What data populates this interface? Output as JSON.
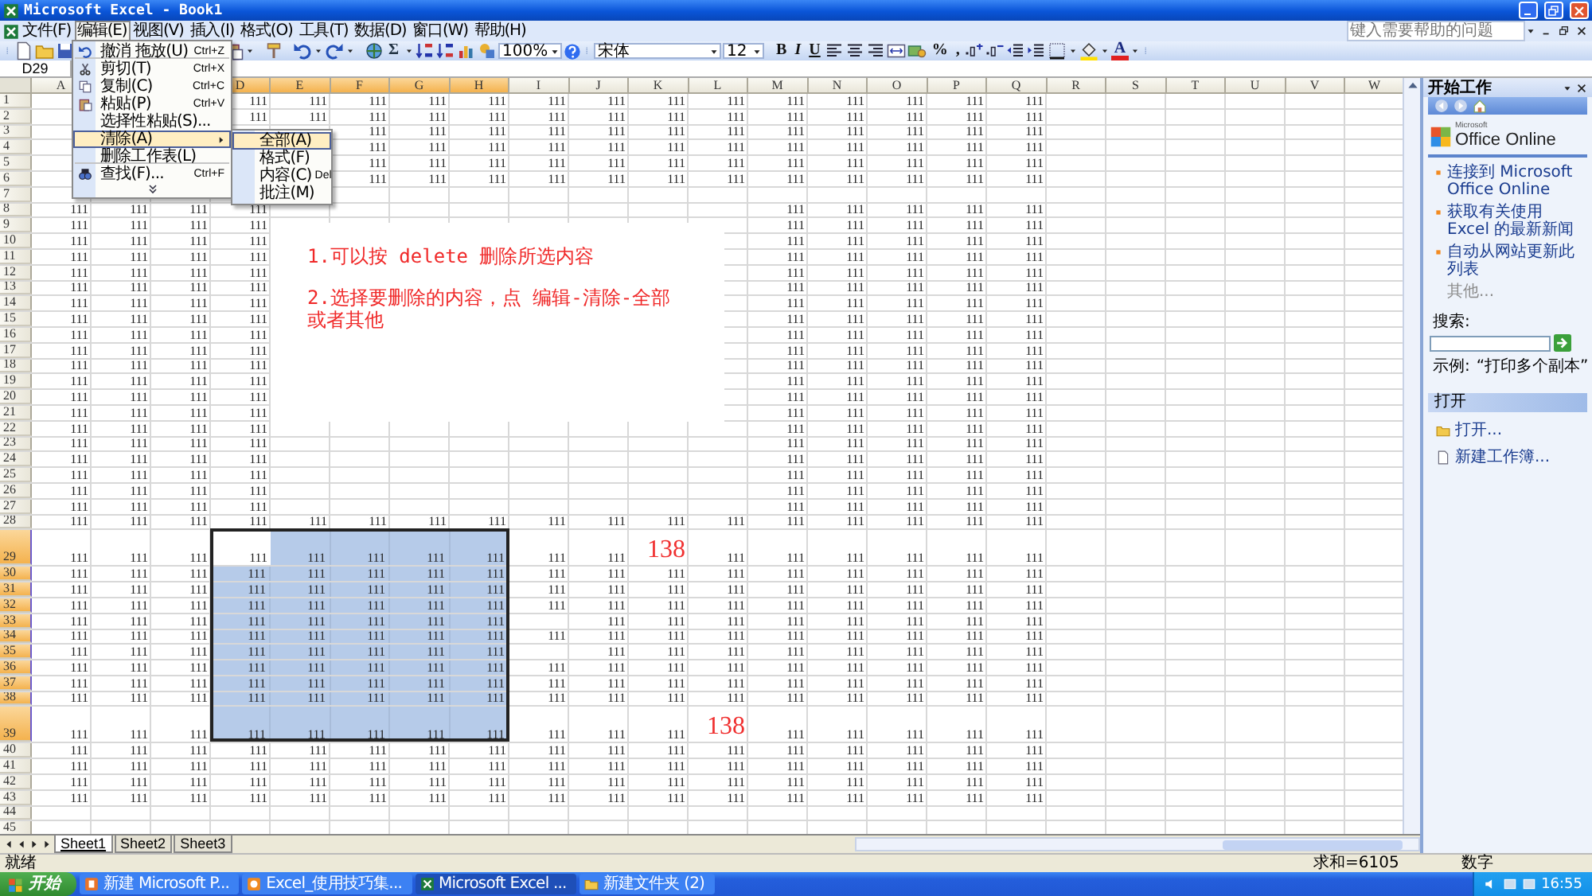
{
  "window": {
    "title": "Microsoft Excel - Book1"
  },
  "menu_bar": {
    "items": [
      {
        "label": "文件(F)",
        "selected": false
      },
      {
        "label": "编辑(E)",
        "selected": true
      },
      {
        "label": "视图(V)",
        "selected": false
      },
      {
        "label": "插入(I)",
        "selected": false
      },
      {
        "label": "格式(O)",
        "selected": false
      },
      {
        "label": "工具(T)",
        "selected": false
      },
      {
        "label": "数据(D)",
        "selected": false
      },
      {
        "label": "窗口(W)",
        "selected": false
      },
      {
        "label": "帮助(H)",
        "selected": false
      }
    ],
    "help_placeholder": "键入需要帮助的问题"
  },
  "toolbar": {
    "sum": "Σ",
    "zoom": "100%",
    "font": "宋体",
    "font_size": "12",
    "bold": "B",
    "italic": "I",
    "underline": "U",
    "percent": "%",
    "comma": ",",
    "font_color": "A"
  },
  "name_box": "D29",
  "edit_menu": {
    "items": [
      {
        "label": "撤消 拖放(U)",
        "shortcut": "Ctrl+Z",
        "selected": false,
        "has_submenu": false,
        "separator_after": true
      },
      {
        "label": "剪切(T)",
        "shortcut": "Ctrl+X",
        "selected": false,
        "has_submenu": false,
        "separator_after": false
      },
      {
        "label": "复制(C)",
        "shortcut": "Ctrl+C",
        "selected": false,
        "has_submenu": false,
        "separator_after": false
      },
      {
        "label": "粘贴(P)",
        "shortcut": "Ctrl+V",
        "selected": false,
        "has_submenu": false,
        "separator_after": false
      },
      {
        "label": "选择性粘贴(S)...",
        "selected": false,
        "has_submenu": false,
        "separator_after": false
      },
      {
        "label": "清除(A)",
        "selected": true,
        "has_submenu": true,
        "separator_after": false
      },
      {
        "label": "删除工作表(L)",
        "selected": false,
        "has_submenu": false,
        "separator_after": true
      },
      {
        "label": "查找(F)...",
        "shortcut": "Ctrl+F",
        "selected": false,
        "has_submenu": false,
        "separator_after": false
      }
    ]
  },
  "clear_submenu": {
    "items": [
      {
        "label": "全部(A)",
        "selected": true
      },
      {
        "label": "格式(F)",
        "selected": false
      },
      {
        "label": "内容(C)",
        "shortcut": "Del",
        "selected": false
      },
      {
        "label": "批注(M)",
        "selected": false
      }
    ]
  },
  "columns": [
    {
      "label": "A",
      "selected": false
    },
    {},
    {},
    {
      "label": "D",
      "selected": true
    },
    {
      "label": "E",
      "selected": true
    },
    {
      "label": "F",
      "selected": true
    },
    {
      "label": "G",
      "selected": true
    },
    {
      "label": "H",
      "selected": true
    },
    {
      "label": "I",
      "selected": false
    },
    {
      "label": "J",
      "selected": false
    },
    {
      "label": "K",
      "selected": false
    },
    {
      "label": "L",
      "selected": false
    },
    {
      "label": "M",
      "selected": false
    },
    {
      "label": "N",
      "selected": false
    },
    {
      "label": "O",
      "selected": false
    },
    {
      "label": "P",
      "selected": false
    },
    {
      "label": "Q",
      "selected": false
    },
    {
      "label": "R",
      "selected": false
    },
    {
      "label": "S",
      "selected": false
    },
    {
      "label": "T",
      "selected": false
    },
    {
      "label": "U",
      "selected": false
    },
    {
      "label": "V",
      "selected": false
    },
    {
      "label": "W",
      "selected": false
    }
  ],
  "rows": [
    {
      "header": "1",
      "kind": "normal",
      "selected": false,
      "cells": [
        null,
        null,
        null,
        "111",
        "111",
        "111",
        "111",
        "111",
        "111",
        "111",
        "111",
        "111",
        "111",
        "111",
        "111",
        "111",
        "111"
      ]
    },
    {
      "header": "2",
      "kind": "normal",
      "selected": false,
      "cells": [
        null,
        null,
        null,
        "111",
        "111",
        "111",
        "111",
        "111",
        "111",
        "111",
        "111",
        "111",
        "111",
        "111",
        "111",
        "111",
        "111"
      ]
    },
    {
      "header": "3",
      "kind": "normal",
      "selected": false,
      "cells": [
        null,
        null,
        null,
        null,
        null,
        "111",
        "111",
        "111",
        "111",
        "111",
        "111",
        "111",
        "111",
        "111",
        "111",
        "111",
        "111"
      ]
    },
    {
      "header": "4",
      "kind": "normal",
      "selected": false,
      "cells": [
        null,
        null,
        null,
        null,
        null,
        "111",
        "111",
        "111",
        "111",
        "111",
        "111",
        "111",
        "111",
        "111",
        "111",
        "111",
        "111"
      ]
    },
    {
      "header": "5",
      "kind": "normal",
      "selected": false,
      "cells": [
        null,
        null,
        null,
        null,
        null,
        "111",
        "111",
        "111",
        "111",
        "111",
        "111",
        "111",
        "111",
        "111",
        "111",
        "111",
        "111"
      ]
    },
    {
      "header": "6",
      "kind": "normal",
      "selected": false,
      "cells": [
        null,
        null,
        null,
        null,
        null,
        "111",
        "111",
        "111",
        "111",
        "111",
        "111",
        "111",
        "111",
        "111",
        "111",
        "111",
        "111"
      ]
    },
    {
      "header": "7",
      "kind": "normal",
      "selected": false
    },
    {
      "header": "8",
      "kind": "normal",
      "selected": false,
      "cells": [
        "111",
        "111",
        "111",
        "111",
        null,
        null,
        null,
        null,
        null,
        null,
        null,
        null,
        "111",
        "111",
        "111",
        "111",
        "111"
      ]
    },
    {
      "header": "9",
      "kind": "normal",
      "selected": false,
      "cells": [
        "111",
        "111",
        "111",
        "111",
        null,
        null,
        null,
        null,
        null,
        null,
        null,
        null,
        "111",
        "111",
        "111",
        "111",
        "111"
      ]
    },
    {
      "header": "10",
      "kind": "normal",
      "selected": false,
      "cells": [
        "111",
        "111",
        "111",
        "111",
        null,
        null,
        null,
        null,
        null,
        null,
        null,
        null,
        "111",
        "111",
        "111",
        "111",
        "111"
      ]
    },
    {
      "header": "11",
      "kind": "normal",
      "selected": false,
      "cells": [
        "111",
        "111",
        "111",
        "111",
        null,
        null,
        null,
        null,
        null,
        null,
        null,
        null,
        "111",
        "111",
        "111",
        "111",
        "111"
      ]
    },
    {
      "header": "12",
      "kind": "normal",
      "selected": false,
      "cells": [
        "111",
        "111",
        "111",
        "111",
        null,
        null,
        null,
        null,
        null,
        null,
        null,
        null,
        "111",
        "111",
        "111",
        "111",
        "111"
      ]
    },
    {
      "header": "13",
      "kind": "normal",
      "selected": false,
      "cells": [
        "111",
        "111",
        "111",
        "111",
        null,
        null,
        null,
        null,
        null,
        null,
        null,
        null,
        "111",
        "111",
        "111",
        "111",
        "111"
      ]
    },
    {
      "header": "14",
      "kind": "normal",
      "selected": false,
      "cells": [
        "111",
        "111",
        "111",
        "111",
        null,
        null,
        null,
        null,
        null,
        null,
        null,
        null,
        "111",
        "111",
        "111",
        "111",
        "111"
      ]
    },
    {
      "header": "15",
      "kind": "normal",
      "selected": false,
      "cells": [
        "111",
        "111",
        "111",
        "111",
        null,
        null,
        null,
        null,
        null,
        null,
        null,
        null,
        "111",
        "111",
        "111",
        "111",
        "111"
      ]
    },
    {
      "header": "16",
      "kind": "normal",
      "selected": false,
      "cells": [
        "111",
        "111",
        "111",
        "111",
        null,
        null,
        null,
        null,
        null,
        null,
        null,
        null,
        "111",
        "111",
        "111",
        "111",
        "111"
      ]
    },
    {
      "header": "17",
      "kind": "normal",
      "selected": false,
      "cells": [
        "111",
        "111",
        "111",
        "111",
        null,
        null,
        null,
        null,
        null,
        null,
        null,
        null,
        "111",
        "111",
        "111",
        "111",
        "111"
      ]
    },
    {
      "header": "18",
      "kind": "normal",
      "selected": false,
      "cells": [
        "111",
        "111",
        "111",
        "111",
        null,
        null,
        null,
        null,
        null,
        null,
        null,
        null,
        "111",
        "111",
        "111",
        "111",
        "111"
      ]
    },
    {
      "header": "19",
      "kind": "normal",
      "selected": false,
      "cells": [
        "111",
        "111",
        "111",
        "111",
        null,
        null,
        null,
        null,
        null,
        null,
        null,
        null,
        "111",
        "111",
        "111",
        "111",
        "111"
      ]
    },
    {
      "header": "20",
      "kind": "normal",
      "selected": false,
      "cells": [
        "111",
        "111",
        "111",
        "111",
        null,
        null,
        null,
        null,
        null,
        null,
        null,
        null,
        "111",
        "111",
        "111",
        "111",
        "111"
      ]
    },
    {
      "header": "21",
      "kind": "normal",
      "selected": false,
      "cells": [
        "111",
        "111",
        "111",
        "111",
        null,
        null,
        null,
        null,
        null,
        null,
        null,
        null,
        "111",
        "111",
        "111",
        "111",
        "111"
      ]
    },
    {
      "header": "22",
      "kind": "normal",
      "selected": false,
      "cells": [
        "111",
        "111",
        "111",
        "111",
        null,
        null,
        null,
        null,
        null,
        null,
        null,
        null,
        "111",
        "111",
        "111",
        "111",
        "111"
      ]
    },
    {
      "header": "23",
      "kind": "normal",
      "selected": false,
      "cells": [
        "111",
        "111",
        "111",
        "111",
        null,
        null,
        null,
        null,
        null,
        null,
        null,
        null,
        "111",
        "111",
        "111",
        "111",
        "111"
      ]
    },
    {
      "header": "24",
      "kind": "normal",
      "selected": false,
      "cells": [
        "111",
        "111",
        "111",
        "111",
        null,
        null,
        null,
        null,
        null,
        null,
        null,
        null,
        "111",
        "111",
        "111",
        "111",
        "111"
      ]
    },
    {
      "header": "25",
      "kind": "normal",
      "selected": false,
      "cells": [
        "111",
        "111",
        "111",
        "111",
        null,
        null,
        null,
        null,
        null,
        null,
        null,
        null,
        "111",
        "111",
        "111",
        "111",
        "111"
      ]
    },
    {
      "header": "26",
      "kind": "normal",
      "selected": false,
      "cells": [
        "111",
        "111",
        "111",
        "111",
        null,
        null,
        null,
        null,
        null,
        null,
        null,
        null,
        "111",
        "111",
        "111",
        "111",
        "111"
      ]
    },
    {
      "header": "27",
      "kind": "normal",
      "selected": false,
      "cells": [
        "111",
        "111",
        "111",
        "111",
        null,
        null,
        null,
        null,
        null,
        null,
        null,
        null,
        "111",
        "111",
        "111",
        "111",
        "111"
      ]
    },
    {
      "header": "28",
      "kind": "normal",
      "selected": false,
      "cells": [
        "111",
        "111",
        "111",
        "111",
        "111",
        "111",
        "111",
        "111",
        "111",
        "111",
        "111",
        "111",
        "111",
        "111",
        "111",
        "111",
        "111"
      ]
    },
    {
      "header": "29",
      "kind": "tall",
      "selected": true,
      "cells": [
        "111",
        "111",
        "111",
        {
          "value": "111",
          "kind": "active"
        },
        "111",
        "111",
        "111",
        "111",
        "111",
        "111",
        {
          "value": "138",
          "kind": "accent"
        },
        "111",
        "111",
        "111",
        "111",
        "111",
        "111"
      ]
    },
    {
      "header": "30",
      "kind": "normal",
      "selected": true,
      "cells": [
        "111",
        "111",
        "111",
        "111",
        "111",
        "111",
        "111",
        "111",
        "111",
        "111",
        "111",
        "111",
        "111",
        "111",
        "111",
        "111",
        "111"
      ]
    },
    {
      "header": "31",
      "kind": "normal",
      "selected": true,
      "cells": [
        "111",
        "111",
        "111",
        "111",
        "111",
        "111",
        "111",
        "111",
        "111",
        "111",
        "111",
        "111",
        "111",
        "111",
        "111",
        "111",
        "111"
      ]
    },
    {
      "header": "32",
      "kind": "normal",
      "selected": true,
      "cells": [
        "111",
        "111",
        "111",
        "111",
        "111",
        "111",
        "111",
        "111",
        "111",
        "111",
        "111",
        "111",
        "111",
        "111",
        "111",
        "111",
        "111"
      ]
    },
    {
      "header": "33",
      "kind": "normal",
      "selected": true,
      "cells": [
        "111",
        "111",
        "111",
        "111",
        "111",
        "111",
        "111",
        "111",
        null,
        "111",
        "111",
        "111",
        "111",
        "111",
        "111",
        "111",
        "111"
      ]
    },
    {
      "header": "34",
      "kind": "normal",
      "selected": true,
      "cells": [
        "111",
        "111",
        "111",
        "111",
        "111",
        "111",
        "111",
        "111",
        "111",
        "111",
        "111",
        "111",
        "111",
        "111",
        "111",
        "111",
        "111"
      ]
    },
    {
      "header": "35",
      "kind": "normal",
      "selected": true,
      "cells": [
        "111",
        "111",
        "111",
        "111",
        "111",
        "111",
        "111",
        "111",
        null,
        "111",
        "111",
        "111",
        "111",
        "111",
        "111",
        "111",
        "111"
      ]
    },
    {
      "header": "36",
      "kind": "normal",
      "selected": true,
      "cells": [
        "111",
        "111",
        "111",
        "111",
        "111",
        "111",
        "111",
        "111",
        "111",
        "111",
        "111",
        "111",
        "111",
        "111",
        "111",
        "111",
        "111"
      ]
    },
    {
      "header": "37",
      "kind": "normal",
      "selected": true,
      "cells": [
        "111",
        "111",
        "111",
        "111",
        "111",
        "111",
        "111",
        "111",
        "111",
        "111",
        "111",
        "111",
        "111",
        "111",
        "111",
        "111",
        "111"
      ]
    },
    {
      "header": "38",
      "kind": "normal",
      "selected": true,
      "cells": [
        "111",
        "111",
        "111",
        "111",
        "111",
        "111",
        "111",
        "111",
        "111",
        "111",
        "111",
        "111",
        "111",
        "111",
        "111",
        "111",
        "111"
      ]
    },
    {
      "header": "39",
      "kind": "tall",
      "selected": true,
      "cells": [
        "111",
        "111",
        "111",
        "111",
        "111",
        "111",
        "111",
        "111",
        "111",
        "111",
        "111",
        {
          "value": "138",
          "kind": "accent"
        },
        "111",
        "111",
        "111",
        "111",
        "111"
      ]
    },
    {
      "header": "40",
      "kind": "normal",
      "selected": false,
      "cells": [
        "111",
        "111",
        "111",
        "111",
        "111",
        "111",
        "111",
        "111",
        "111",
        "111",
        "111",
        "111",
        "111",
        "111",
        "111",
        "111",
        "111"
      ]
    },
    {
      "header": "41",
      "kind": "normal",
      "selected": false,
      "cells": [
        "111",
        "111",
        "111",
        "111",
        "111",
        "111",
        "111",
        "111",
        "111",
        "111",
        "111",
        "111",
        "111",
        "111",
        "111",
        "111",
        "111"
      ]
    },
    {
      "header": "42",
      "kind": "normal",
      "selected": false,
      "cells": [
        "111",
        "111",
        "111",
        "111",
        "111",
        "111",
        "111",
        "111",
        "111",
        "111",
        "111",
        "111",
        "111",
        "111",
        "111",
        "111",
        "111"
      ]
    },
    {
      "header": "43",
      "kind": "normal",
      "selected": false,
      "cells": [
        "111",
        "111",
        "111",
        "111",
        "111",
        "111",
        "111",
        "111",
        "111",
        "111",
        "111",
        "111",
        "111",
        "111",
        "111",
        "111",
        "111"
      ]
    },
    {
      "header": "44",
      "kind": "normal",
      "selected": false
    },
    {
      "header": "45",
      "kind": "normal",
      "selected": false
    }
  ],
  "note_box": {
    "lines": [
      "1.可以按 delete 删除所选内容",
      "2.选择要删除的内容，点 编辑-清除-全部或者其他"
    ]
  },
  "task_pane": {
    "title": "开始工作",
    "logo_small": "Microsoft",
    "logo": "Office Online",
    "links": [
      "连接到 Microsoft Office Online",
      "获取有关使用 Excel 的最新新闻",
      "自动从网站更新此列表"
    ],
    "more": "其他...",
    "search_label": "搜索:",
    "example_label": "示例:",
    "example": "“打印多个副本”",
    "open_heading": "打开",
    "open_items": [
      "打开...",
      "新建工作簿..."
    ]
  },
  "sheet_tabs": [
    {
      "label": "Sheet1",
      "selected": true
    },
    {
      "label": "Sheet2",
      "selected": false
    },
    {
      "label": "Sheet3",
      "selected": false
    }
  ],
  "status_bar": {
    "state": "就绪",
    "sum": "求和=6105",
    "mode": "数字"
  },
  "taskbar": {
    "start": "开始",
    "tasks": [
      {
        "label": "新建 Microsoft P...",
        "selected": false
      },
      {
        "label": "Excel_使用技巧集...",
        "selected": false
      },
      {
        "label": "Microsoft Excel ...",
        "selected": true
      },
      {
        "label": "新建文件夹 (2)",
        "selected": false
      }
    ],
    "clock": "16:55"
  }
}
